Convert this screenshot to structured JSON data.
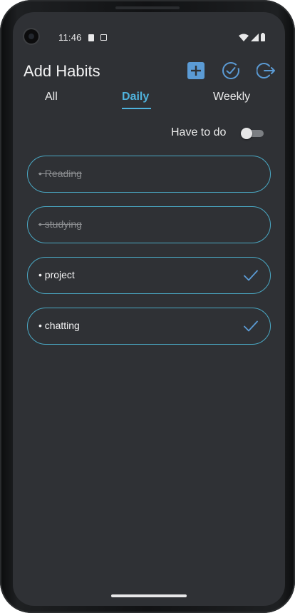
{
  "status_bar": {
    "time": "11:46",
    "icons": [
      "sim-card-icon",
      "screenshot-icon",
      "wifi-icon",
      "cell-signal-icon",
      "battery-icon"
    ]
  },
  "header": {
    "title": "Add Habits",
    "actions": [
      "add-habit-icon",
      "check-circle-icon",
      "logout-icon"
    ],
    "accent": "#5b9bd5"
  },
  "tabs": [
    {
      "label": "All",
      "active": false
    },
    {
      "label": "Daily",
      "active": true
    },
    {
      "label": "Weekly",
      "active": false
    }
  ],
  "active_tab_color": "#4fb3dd",
  "filter": {
    "label": "Have to do",
    "enabled": false
  },
  "habits": [
    {
      "label": "• Reading",
      "completed": true
    },
    {
      "label": "• studying",
      "completed": true
    },
    {
      "label": "• project",
      "completed": false
    },
    {
      "label": "• chatting",
      "completed": false
    }
  ],
  "habit_border_color": "#4aa8c4"
}
